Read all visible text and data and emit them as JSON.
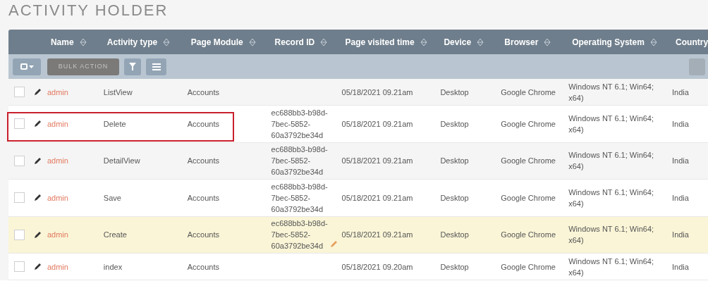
{
  "page_title": "ACTIVITY HOLDER",
  "table": {
    "columns": [
      {
        "label": "Name"
      },
      {
        "label": "Activity type"
      },
      {
        "label": "Page Module"
      },
      {
        "label": "Record ID"
      },
      {
        "label": "Page visited time"
      },
      {
        "label": "Device"
      },
      {
        "label": "Browser"
      },
      {
        "label": "Operating System"
      },
      {
        "label": "Country"
      }
    ],
    "toolbar": {
      "bulk_action": "BULK ACTION"
    },
    "rows": [
      {
        "name": "admin",
        "activity_type": "ListView",
        "page_module": "Accounts",
        "record_id": "",
        "time": "05/18/2021 09.21am",
        "device": "Desktop",
        "browser": "Google Chrome",
        "os": "Windows NT 6.1; Win64; x64)",
        "country": "India",
        "checked": false,
        "highlighted": false,
        "outlined": false,
        "inline_edit": false
      },
      {
        "name": "admin",
        "activity_type": "Delete",
        "page_module": "Accounts",
        "record_id": "ec688bb3-b98d-7bec-5852-60a3792be34d",
        "time": "05/18/2021 09.21am",
        "device": "Desktop",
        "browser": "Google Chrome",
        "os": "Windows NT 6.1; Win64; x64)",
        "country": "India",
        "checked": false,
        "highlighted": false,
        "outlined": true,
        "inline_edit": false
      },
      {
        "name": "admin",
        "activity_type": "DetailView",
        "page_module": "Accounts",
        "record_id": "ec688bb3-b98d-7bec-5852-60a3792be34d",
        "time": "05/18/2021 09.21am",
        "device": "Desktop",
        "browser": "Google Chrome",
        "os": "Windows NT 6.1; Win64; x64)",
        "country": "India",
        "checked": false,
        "highlighted": false,
        "outlined": false,
        "inline_edit": false
      },
      {
        "name": "admin",
        "activity_type": "Save",
        "page_module": "Accounts",
        "record_id": "ec688bb3-b98d-7bec-5852-60a3792be34d",
        "time": "05/18/2021 09.21am",
        "device": "Desktop",
        "browser": "Google Chrome",
        "os": "Windows NT 6.1; Win64; x64)",
        "country": "India",
        "checked": false,
        "highlighted": false,
        "outlined": false,
        "inline_edit": false
      },
      {
        "name": "admin",
        "activity_type": "Create",
        "page_module": "Accounts",
        "record_id": "ec688bb3-b98d-7bec-5852-60a3792be34d",
        "time": "05/18/2021 09.21am",
        "device": "Desktop",
        "browser": "Google Chrome",
        "os": "Windows NT 6.1; Win64; x64)",
        "country": "India",
        "checked": false,
        "highlighted": true,
        "outlined": false,
        "inline_edit": true
      },
      {
        "name": "admin",
        "activity_type": "index",
        "page_module": "Accounts",
        "record_id": "",
        "time": "05/18/2021 09.20am",
        "device": "Desktop",
        "browser": "Google Chrome",
        "os": "Windows NT 6.1; Win64; x64)",
        "country": "India",
        "checked": false,
        "highlighted": false,
        "outlined": false,
        "inline_edit": false
      }
    ]
  }
}
